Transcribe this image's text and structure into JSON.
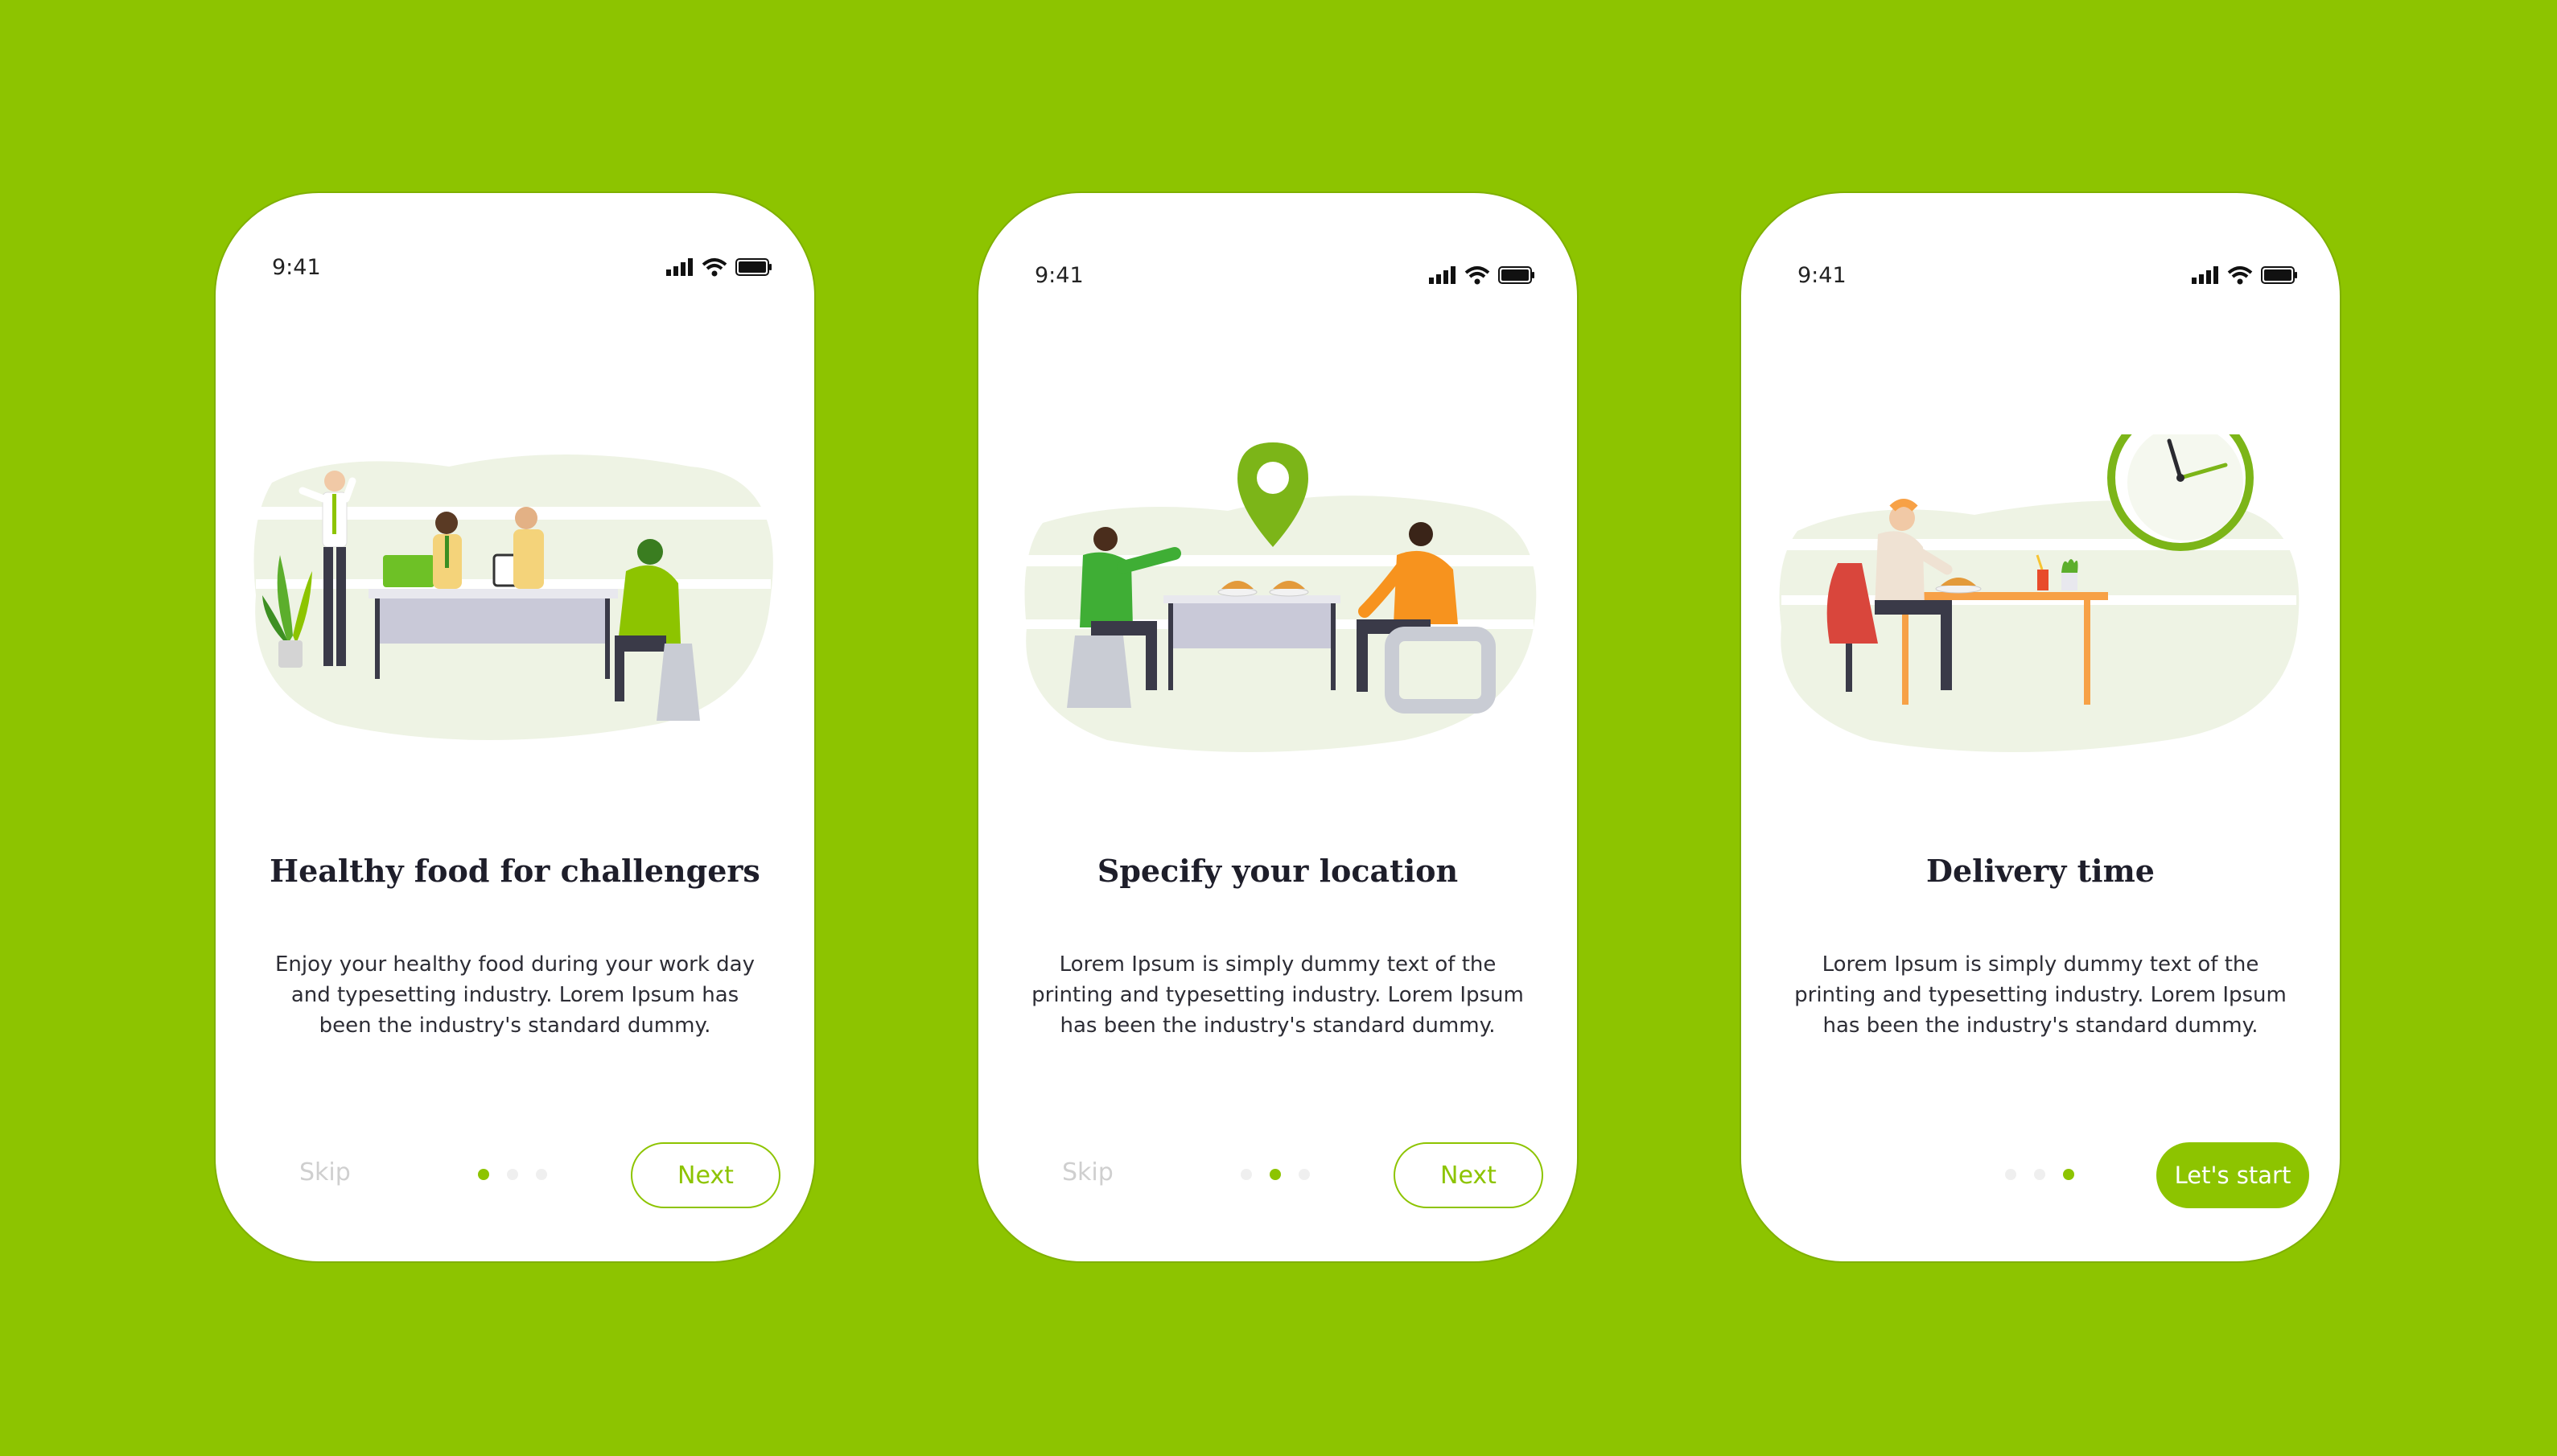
{
  "screens": [
    {
      "status_time": "9:41",
      "title": "Healthy food for challengers",
      "description": "Enjoy your healthy food during your work day and typesetting industry. Lorem Ipsum has been the industry's standard dummy.",
      "skip_label": "Skip",
      "action_label": "Next",
      "active_step": 1,
      "total_steps": 3,
      "illustration": "office-team-working-illustration"
    },
    {
      "status_time": "9:41",
      "title": "Specify your location",
      "description": "Lorem Ipsum is simply dummy text of the printing and typesetting industry. Lorem Ipsum has been the industry's standard dummy.",
      "skip_label": "Skip",
      "action_label": "Next",
      "active_step": 2,
      "total_steps": 3,
      "illustration": "location-pin-dining-illustration"
    },
    {
      "status_time": "9:41",
      "title": "Delivery time",
      "description": "Lorem Ipsum is simply dummy text of the printing and typesetting industry. Lorem Ipsum has been the industry's standard dummy.",
      "action_label": "Let's start",
      "active_step": 3,
      "total_steps": 3,
      "illustration": "clock-meal-illustration"
    }
  ],
  "colors": {
    "background": "#8dc400",
    "accent": "#8dc400",
    "title": "#1e1e2a",
    "body": "#2d2d35",
    "muted": "#cfcfcf",
    "dot_inactive": "#efefef"
  }
}
